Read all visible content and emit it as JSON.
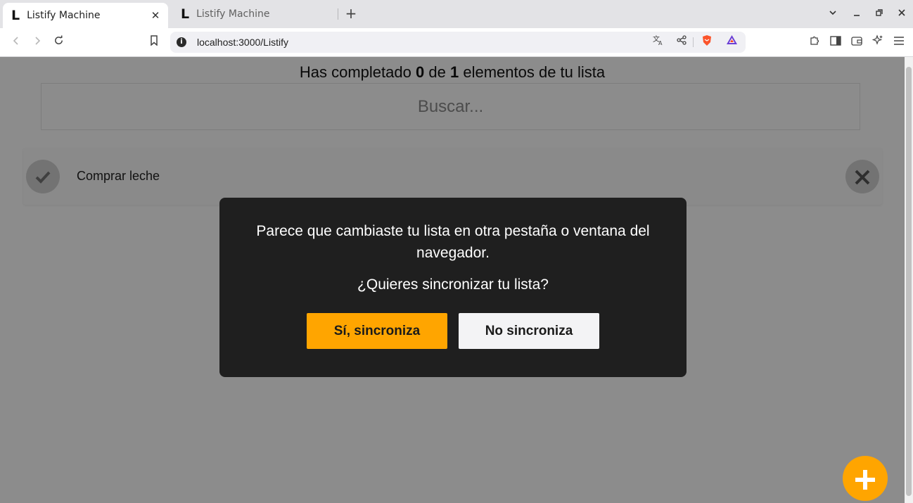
{
  "browser": {
    "tabs": [
      {
        "favicon": "L",
        "title": "Listify Machine",
        "close": "✕"
      },
      {
        "favicon": "L",
        "title": "Listify Machine"
      }
    ],
    "new_tab": "+",
    "url": "localhost:3000/Listify"
  },
  "app": {
    "status": {
      "prefix": "Has completado",
      "done": "0",
      "middle": "de",
      "total": "1",
      "suffix": "elementos de tu lista"
    },
    "search_placeholder": "Buscar...",
    "items": [
      {
        "text": "Comprar leche",
        "completed": false
      }
    ],
    "fab_label": "+"
  },
  "dialog": {
    "message": "Parece que cambiaste tu lista en otra pestaña o ventana del navegador.",
    "question": "¿Quieres sincronizar tu lista?",
    "confirm_label": "Sí, sincroniza",
    "cancel_label": "No sincroniza"
  },
  "colors": {
    "accent": "#ffa500",
    "dialog_bg": "#1f1f1f",
    "overlay": "rgba(0,0,0,0.45)"
  },
  "icons": {
    "check": "check-icon",
    "delete": "close-icon",
    "add": "plus-icon"
  }
}
